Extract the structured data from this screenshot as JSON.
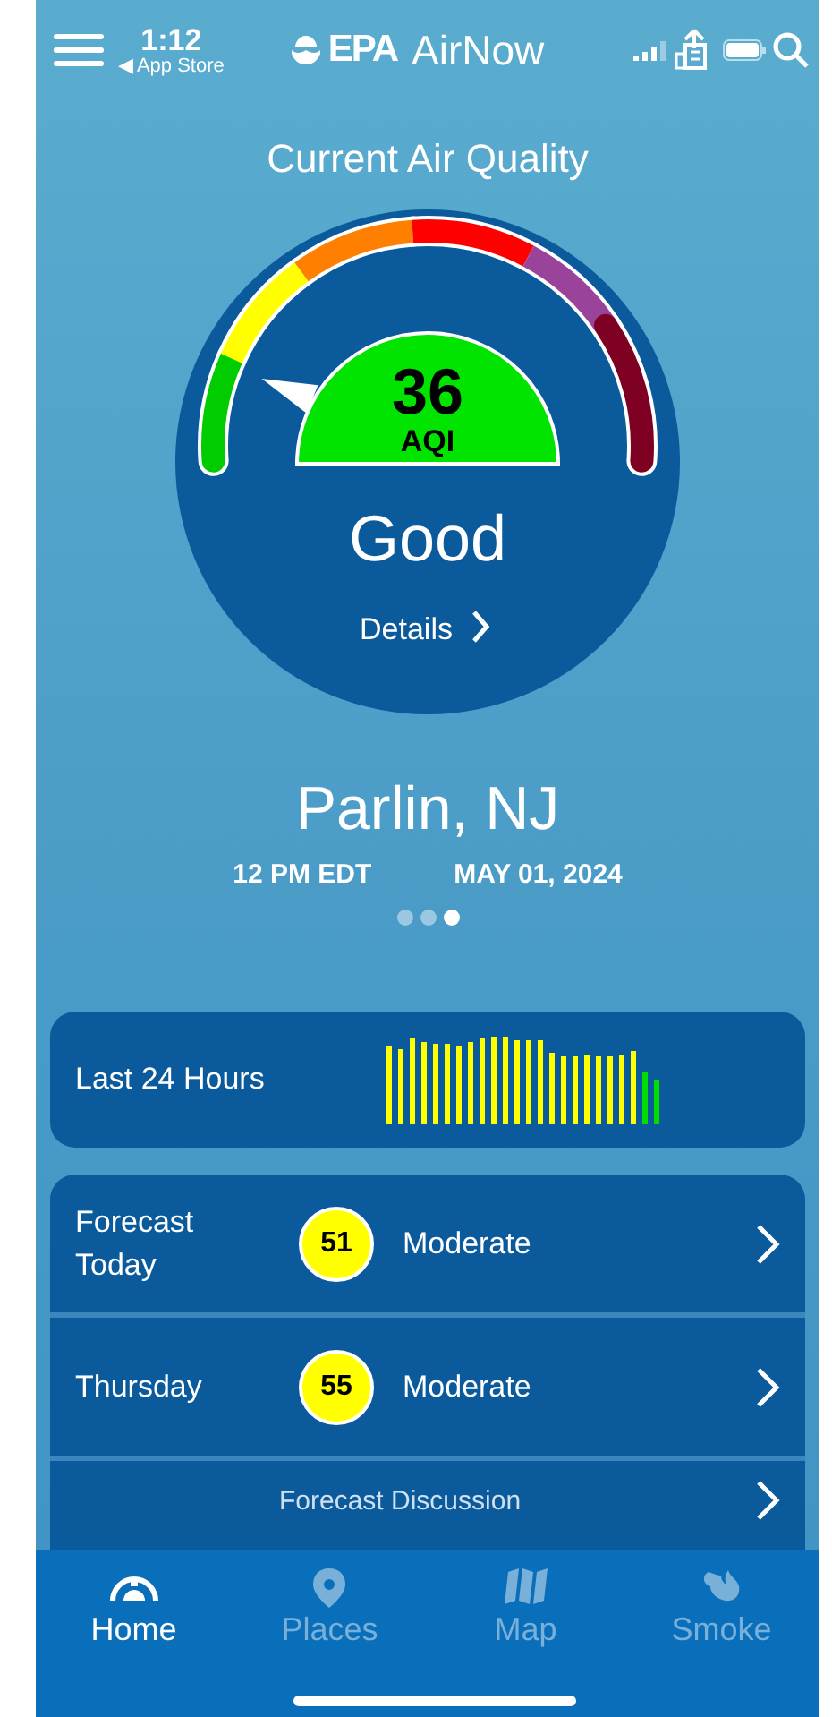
{
  "status_bar": {
    "time": "1:12",
    "back_label": "◀ App Store"
  },
  "header": {
    "logo_text": "EPA",
    "app_name": "AirNow"
  },
  "title": "Current Air Quality",
  "gauge": {
    "value": "36",
    "unit": "AQI",
    "category": "Good",
    "details_link": "Details"
  },
  "location": {
    "name": "Parlin, NJ",
    "time": "12 PM EDT",
    "date": "MAY 01, 2024"
  },
  "pages": [
    {
      "selected": false
    },
    {
      "selected": false
    },
    {
      "selected": true
    }
  ],
  "history": {
    "label": "Last 24 Hours"
  },
  "forecast": [
    {
      "kind": "day",
      "label": "Forecast Today",
      "value": "51",
      "category": "Moderate",
      "color": "#ffff00"
    },
    {
      "kind": "day",
      "label": "Thursday",
      "value": "55",
      "category": "Moderate",
      "color": "#ffff00"
    },
    {
      "kind": "link",
      "label": "Forecast Discussion"
    }
  ],
  "tabs": [
    {
      "label": "Home",
      "kind": "home",
      "selected": true
    },
    {
      "label": "Places",
      "kind": "places",
      "selected": false
    },
    {
      "label": "Map",
      "kind": "map",
      "selected": false
    },
    {
      "label": "Smoke",
      "kind": "smoke",
      "selected": false
    }
  ]
}
